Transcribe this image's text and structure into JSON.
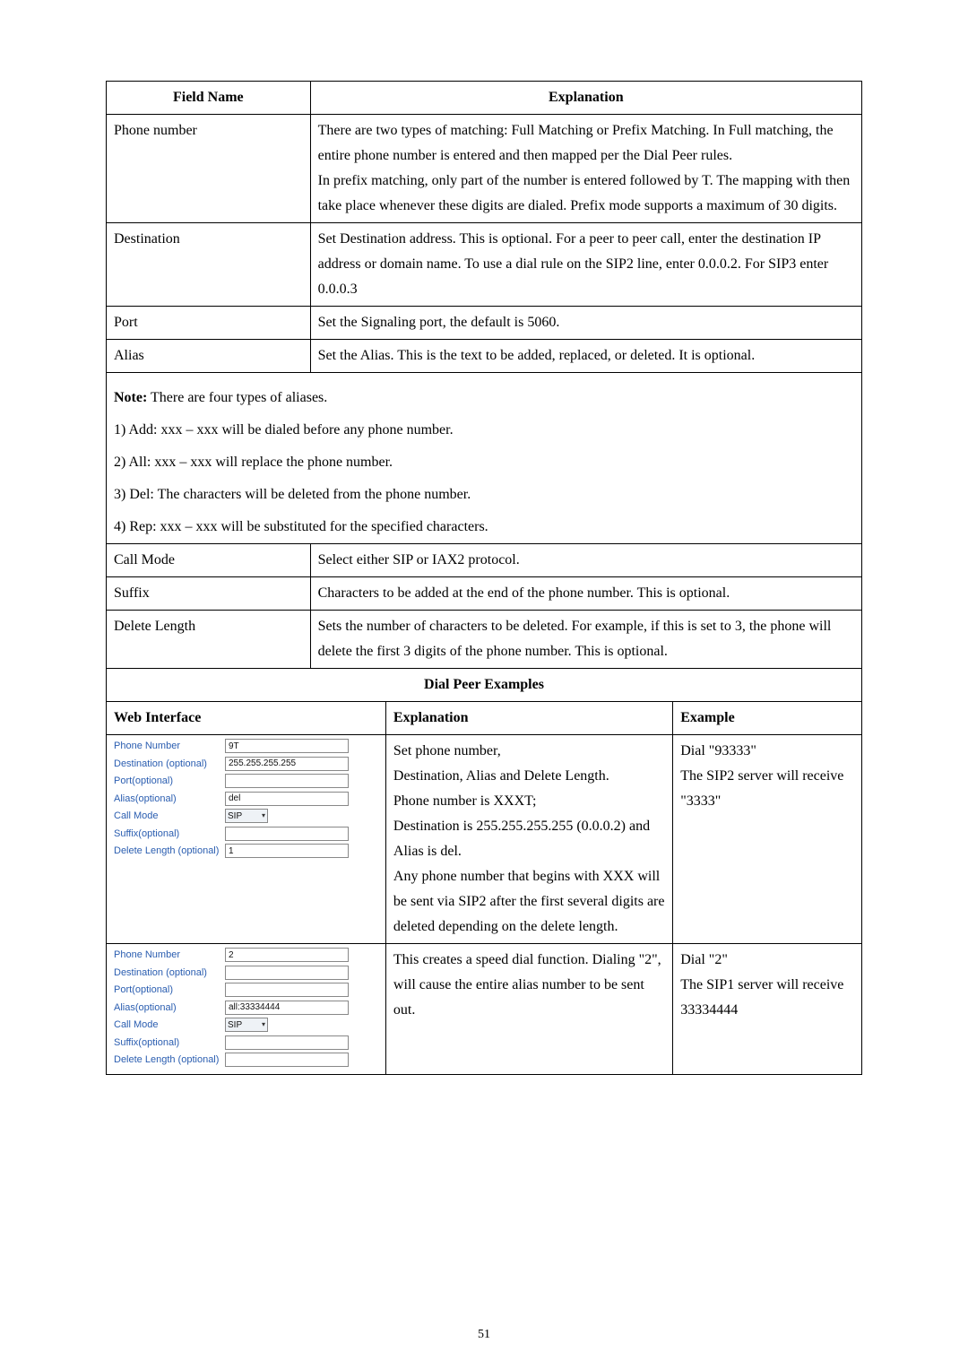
{
  "table1": {
    "headers": {
      "field": "Field Name",
      "expl": "Explanation"
    },
    "rows": [
      {
        "field": "Phone number",
        "expl": "There are two types of matching: Full Matching or Prefix Matching. In Full matching, the entire phone number is entered and then mapped per the Dial Peer rules.\nIn prefix matching, only part of the number is entered followed by T.    The mapping with then take place whenever these digits are dialed.    Prefix mode supports a maximum of 30 digits."
      },
      {
        "field": "Destination",
        "expl": "Set Destination address. This is optional. For a peer to peer call, enter the destination IP address or domain name. To use a dial rule on the SIP2 line, enter 0.0.0.2.    For SIP3 enter 0.0.0.3"
      },
      {
        "field": "Port",
        "expl": "Set the Signaling port, the default is 5060."
      },
      {
        "field": "Alias",
        "expl": "Set the Alias. This is the text to be added, replaced, or deleted. It is optional."
      }
    ]
  },
  "note": {
    "heading": "Note:",
    "heading_rest": " There are four types of aliases.",
    "lines": [
      "1) Add: xxx – xxx will be dialed before any phone number.",
      "2) All: xxx – xxx will replace the phone number.",
      "3) Del: The characters will be deleted from the phone number.",
      "4) Rep: xxx – xxx will be substituted for the specified characters."
    ]
  },
  "table2": {
    "rows": [
      {
        "field": "Call Mode",
        "expl": "Select either SIP or IAX2 protocol."
      },
      {
        "field": "Suffix",
        "expl": "Characters to be added at the end of the phone number.    This is optional."
      },
      {
        "field": "Delete Length",
        "expl": "Sets the number of characters to be deleted. For example, if this is set to 3, the phone will delete the first 3 digits of the phone number. This is optional."
      }
    ]
  },
  "dialpeer": {
    "heading": "Dial Peer Examples",
    "headers": {
      "web": "Web Interface",
      "expl": "Explanation",
      "ex": "Example"
    },
    "row1": {
      "form": {
        "phone_label": "Phone Number",
        "phone_val": "9T",
        "dest_label": "Destination (optional)",
        "dest_val": "255.255.255.255",
        "port_label": "Port(optional)",
        "port_val": "",
        "alias_label": "Alias(optional)",
        "alias_val": "del",
        "mode_label": "Call Mode",
        "mode_val": "SIP",
        "suffix_label": "Suffix(optional)",
        "suffix_val": "",
        "dellen_label": "Delete Length (optional)",
        "dellen_val": "1"
      },
      "expl": "Set phone number,\nDestination, Alias and Delete Length.\nPhone number is XXXT;\nDestination is 255.255.255.255 (0.0.0.2) and Alias is del.\nAny phone number that begins with XXX will be sent via SIP2 after the first several digits are deleted depending on the delete length.",
      "ex": "Dial \"93333\"\nThe SIP2 server will receive \"3333\""
    },
    "row2": {
      "form": {
        "phone_label": "Phone Number",
        "phone_val": "2",
        "dest_label": "Destination (optional)",
        "dest_val": "",
        "port_label": "Port(optional)",
        "port_val": "",
        "alias_label": "Alias(optional)",
        "alias_val": "all:33334444",
        "mode_label": "Call Mode",
        "mode_val": "SIP",
        "suffix_label": "Suffix(optional)",
        "suffix_val": "",
        "dellen_label": "Delete Length (optional)",
        "dellen_val": ""
      },
      "expl": "This creates a speed dial function.    Dialing \"2\", will cause the entire alias number to be sent out.",
      "ex": "Dial \"2\"\nThe SIP1 server will receive 33334444"
    }
  },
  "page_number": "51"
}
